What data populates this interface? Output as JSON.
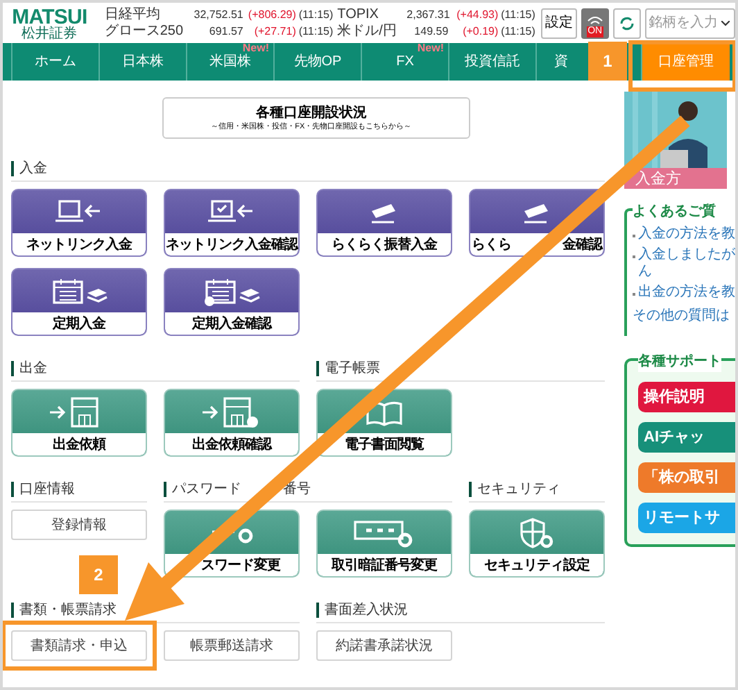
{
  "header": {
    "logo": "MATSUI",
    "logo_sub": "松井証券",
    "quotes": [
      {
        "name": "日経平均",
        "value": "32,752.51",
        "change": "(+806.29)",
        "time": "(11:15)",
        "name2": "TOPIX",
        "value2": "2,367.31",
        "change2": "(+44.93)",
        "time2": "(11:15)"
      },
      {
        "name": "グロース250",
        "value": "691.57",
        "change": "(+27.71)",
        "time": "(11:15)",
        "name2": "米ドル/円",
        "value2": "149.59",
        "change2": "(+0.19)",
        "time2": "(11:15)"
      }
    ],
    "settings_button": "設定",
    "push_label": "ON",
    "search": {
      "placeholder": "銘柄を入力"
    }
  },
  "nav": [
    {
      "label": "ホーム",
      "selected": false
    },
    {
      "label": "日本株",
      "selected": false
    },
    {
      "label": "米国株",
      "badge": "New!",
      "selected": false
    },
    {
      "label": "先物OP",
      "selected": false
    },
    {
      "label": "FX",
      "badge": "New!",
      "selected": false
    },
    {
      "label": "投資信託",
      "selected": false
    },
    {
      "label": "資",
      "selected": false
    },
    {
      "label": "口座管理",
      "selected": true
    }
  ],
  "banner": {
    "title": "各種口座開設状況",
    "subtitle": "～信用・米国株・投信・FX・先物口座開設もこちらから～"
  },
  "rows": [
    [
      {
        "title": [
          "入金"
        ],
        "tiles": [
          {
            "kind": "purple",
            "label": [
              "ネットリンク入金"
            ]
          },
          {
            "kind": "purple",
            "label": [
              "ネットリンク入金確認"
            ]
          },
          {
            "kind": "purple",
            "label": [
              "らくらく振替入金"
            ]
          },
          {
            "kind": "purple",
            "label": [
              "らくら",
              "金確認"
            ]
          },
          {
            "kind": "purple",
            "label": [
              "定期入金"
            ]
          },
          {
            "kind": "purple",
            "label": [
              "定期入金確認"
            ]
          }
        ]
      }
    ],
    [
      {
        "title": [
          "出金"
        ],
        "tiles": [
          {
            "kind": "green",
            "label": [
              "出金依頼"
            ]
          },
          {
            "kind": "green",
            "label": [
              "出金依頼確認"
            ]
          }
        ]
      },
      {
        "title": [
          "電子帳票"
        ],
        "tiles": [
          {
            "kind": "green",
            "label": [
              "電子書面閲覧"
            ]
          }
        ]
      }
    ],
    [
      {
        "title": [
          "口座情報"
        ],
        "tiles": [
          {
            "kind": "plain",
            "label": [
              "登録情報"
            ]
          }
        ]
      },
      {
        "title": [
          "パスワード",
          "番号"
        ],
        "tiles": [
          {
            "kind": "green",
            "label": [
              "スワード変更"
            ]
          },
          {
            "kind": "green",
            "label": [
              "取引暗証番号変更"
            ]
          }
        ]
      },
      {
        "title": [
          "セキュリティ"
        ],
        "tiles": [
          {
            "kind": "green",
            "label": [
              "セキュリティ設定"
            ]
          }
        ]
      }
    ],
    [
      {
        "title": [
          "書類・帳票請求"
        ],
        "tiles": [
          {
            "kind": "plain",
            "label": [
              "書類請求・申込"
            ],
            "highlighted": true
          },
          {
            "kind": "plain",
            "label": [
              "帳票郵送請求"
            ],
            "highlighted": false
          }
        ]
      },
      {
        "title": [
          "書面差入状況"
        ],
        "tiles": [
          {
            "kind": "plain",
            "label": [
              "約諾書承諾状況"
            ],
            "highlighted": false
          }
        ]
      }
    ]
  ],
  "sidebar": {
    "promo": "入金方",
    "faq_title": "よくあるご質",
    "faq": [
      {
        "lines": [
          "入金の方法を教"
        ]
      },
      {
        "lines": [
          "入金しましたが",
          "ん"
        ]
      },
      {
        "lines": [
          "出金の方法を教"
        ]
      }
    ],
    "faq_more": "その他の質問は",
    "support_title": "各種サポート",
    "support": [
      {
        "label": "操作説明",
        "color": "#e0173f"
      },
      {
        "label": "AIチャッ",
        "color": "#17907a"
      },
      {
        "label": "「株の取引",
        "color": "#ee7a2a"
      },
      {
        "label": "リモートサ",
        "color": "#1ba6e6"
      }
    ]
  },
  "callouts": [
    {
      "number": "1"
    },
    {
      "number": "2"
    }
  ]
}
